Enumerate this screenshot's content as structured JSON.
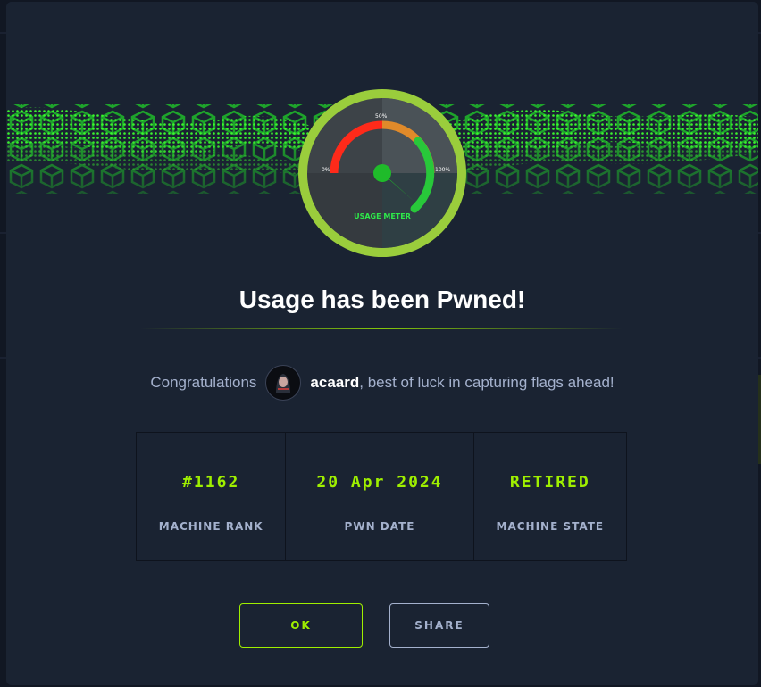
{
  "modal": {
    "gauge": {
      "label": "USAGE METER",
      "tick_0": "0%",
      "tick_50": "50%",
      "tick_100": "100%"
    },
    "title": "Usage has been Pwned!",
    "congrats": {
      "prefix": "Congratulations",
      "username": "acaard",
      "suffix": ", best of luck in capturing flags ahead!"
    },
    "stats": [
      {
        "value": "#1162",
        "label": "MACHINE RANK"
      },
      {
        "value": "20 Apr 2024",
        "label": "PWN DATE"
      },
      {
        "value": "RETIRED",
        "label": "MACHINE STATE"
      }
    ],
    "buttons": {
      "ok": "OK",
      "share": "SHARE"
    }
  },
  "colors": {
    "accent": "#9fef00",
    "modal_bg": "#1a2332",
    "muted_text": "#a4b1cd"
  }
}
